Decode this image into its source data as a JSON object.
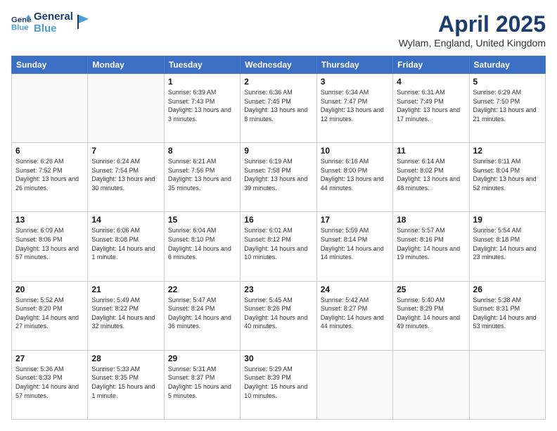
{
  "logo": {
    "line1": "General",
    "line2": "Blue"
  },
  "title": "April 2025",
  "subtitle": "Wylam, England, United Kingdom",
  "headers": [
    "Sunday",
    "Monday",
    "Tuesday",
    "Wednesday",
    "Thursday",
    "Friday",
    "Saturday"
  ],
  "weeks": [
    [
      {
        "day": "",
        "detail": ""
      },
      {
        "day": "",
        "detail": ""
      },
      {
        "day": "1",
        "detail": "Sunrise: 6:39 AM\nSunset: 7:43 PM\nDaylight: 13 hours and 3 minutes."
      },
      {
        "day": "2",
        "detail": "Sunrise: 6:36 AM\nSunset: 7:45 PM\nDaylight: 13 hours and 8 minutes."
      },
      {
        "day": "3",
        "detail": "Sunrise: 6:34 AM\nSunset: 7:47 PM\nDaylight: 13 hours and 12 minutes."
      },
      {
        "day": "4",
        "detail": "Sunrise: 6:31 AM\nSunset: 7:49 PM\nDaylight: 13 hours and 17 minutes."
      },
      {
        "day": "5",
        "detail": "Sunrise: 6:29 AM\nSunset: 7:50 PM\nDaylight: 13 hours and 21 minutes."
      }
    ],
    [
      {
        "day": "6",
        "detail": "Sunrise: 6:26 AM\nSunset: 7:52 PM\nDaylight: 13 hours and 26 minutes."
      },
      {
        "day": "7",
        "detail": "Sunrise: 6:24 AM\nSunset: 7:54 PM\nDaylight: 13 hours and 30 minutes."
      },
      {
        "day": "8",
        "detail": "Sunrise: 6:21 AM\nSunset: 7:56 PM\nDaylight: 13 hours and 35 minutes."
      },
      {
        "day": "9",
        "detail": "Sunrise: 6:19 AM\nSunset: 7:58 PM\nDaylight: 13 hours and 39 minutes."
      },
      {
        "day": "10",
        "detail": "Sunrise: 6:16 AM\nSunset: 8:00 PM\nDaylight: 13 hours and 44 minutes."
      },
      {
        "day": "11",
        "detail": "Sunrise: 6:14 AM\nSunset: 8:02 PM\nDaylight: 13 hours and 48 minutes."
      },
      {
        "day": "12",
        "detail": "Sunrise: 6:11 AM\nSunset: 8:04 PM\nDaylight: 13 hours and 52 minutes."
      }
    ],
    [
      {
        "day": "13",
        "detail": "Sunrise: 6:09 AM\nSunset: 8:06 PM\nDaylight: 13 hours and 57 minutes."
      },
      {
        "day": "14",
        "detail": "Sunrise: 6:06 AM\nSunset: 8:08 PM\nDaylight: 14 hours and 1 minute."
      },
      {
        "day": "15",
        "detail": "Sunrise: 6:04 AM\nSunset: 8:10 PM\nDaylight: 14 hours and 6 minutes."
      },
      {
        "day": "16",
        "detail": "Sunrise: 6:01 AM\nSunset: 8:12 PM\nDaylight: 14 hours and 10 minutes."
      },
      {
        "day": "17",
        "detail": "Sunrise: 5:59 AM\nSunset: 8:14 PM\nDaylight: 14 hours and 14 minutes."
      },
      {
        "day": "18",
        "detail": "Sunrise: 5:57 AM\nSunset: 8:16 PM\nDaylight: 14 hours and 19 minutes."
      },
      {
        "day": "19",
        "detail": "Sunrise: 5:54 AM\nSunset: 8:18 PM\nDaylight: 14 hours and 23 minutes."
      }
    ],
    [
      {
        "day": "20",
        "detail": "Sunrise: 5:52 AM\nSunset: 8:20 PM\nDaylight: 14 hours and 27 minutes."
      },
      {
        "day": "21",
        "detail": "Sunrise: 5:49 AM\nSunset: 8:22 PM\nDaylight: 14 hours and 32 minutes."
      },
      {
        "day": "22",
        "detail": "Sunrise: 5:47 AM\nSunset: 8:24 PM\nDaylight: 14 hours and 36 minutes."
      },
      {
        "day": "23",
        "detail": "Sunrise: 5:45 AM\nSunset: 8:26 PM\nDaylight: 14 hours and 40 minutes."
      },
      {
        "day": "24",
        "detail": "Sunrise: 5:42 AM\nSunset: 8:27 PM\nDaylight: 14 hours and 44 minutes."
      },
      {
        "day": "25",
        "detail": "Sunrise: 5:40 AM\nSunset: 8:29 PM\nDaylight: 14 hours and 49 minutes."
      },
      {
        "day": "26",
        "detail": "Sunrise: 5:38 AM\nSunset: 8:31 PM\nDaylight: 14 hours and 53 minutes."
      }
    ],
    [
      {
        "day": "27",
        "detail": "Sunrise: 5:36 AM\nSunset: 8:33 PM\nDaylight: 14 hours and 57 minutes."
      },
      {
        "day": "28",
        "detail": "Sunrise: 5:33 AM\nSunset: 8:35 PM\nDaylight: 15 hours and 1 minute."
      },
      {
        "day": "29",
        "detail": "Sunrise: 5:31 AM\nSunset: 8:37 PM\nDaylight: 15 hours and 5 minutes."
      },
      {
        "day": "30",
        "detail": "Sunrise: 5:29 AM\nSunset: 8:39 PM\nDaylight: 15 hours and 10 minutes."
      },
      {
        "day": "",
        "detail": ""
      },
      {
        "day": "",
        "detail": ""
      },
      {
        "day": "",
        "detail": ""
      }
    ]
  ]
}
